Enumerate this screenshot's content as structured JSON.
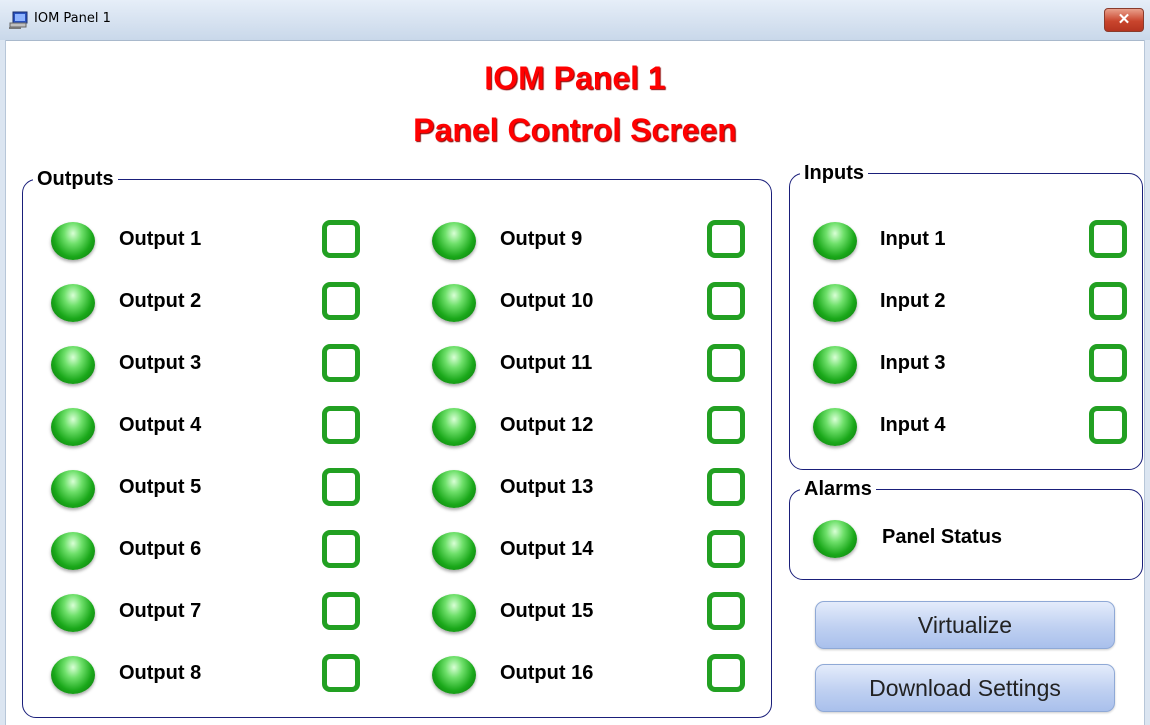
{
  "window": {
    "title": "IOM Panel 1",
    "close_label": "✕"
  },
  "header": {
    "title": "IOM Panel 1",
    "subtitle": "Panel Control Screen"
  },
  "outputs": {
    "legend": "Outputs",
    "column1": [
      "Output 1",
      "Output 2",
      "Output 3",
      "Output 4",
      "Output 5",
      "Output 6",
      "Output 7",
      "Output 8"
    ],
    "column2": [
      "Output 9",
      "Output 10",
      "Output 11",
      "Output 12",
      "Output 13",
      "Output 14",
      "Output 15",
      "Output 16"
    ]
  },
  "inputs": {
    "legend": "Inputs",
    "items": [
      "Input 1",
      "Input 2",
      "Input 3",
      "Input 4"
    ]
  },
  "alarms": {
    "legend": "Alarms",
    "items": [
      "Panel Status"
    ]
  },
  "buttons": {
    "virtualize": "Virtualize",
    "download": "Download Settings"
  },
  "colors": {
    "title_red": "#ff0000",
    "led_green": "#1aa81a",
    "checkbox_green": "#22a022",
    "group_border": "#1a1f7a"
  },
  "icons": {
    "app": "computer-icon",
    "led": "led-indicator-icon",
    "close": "close-icon"
  }
}
